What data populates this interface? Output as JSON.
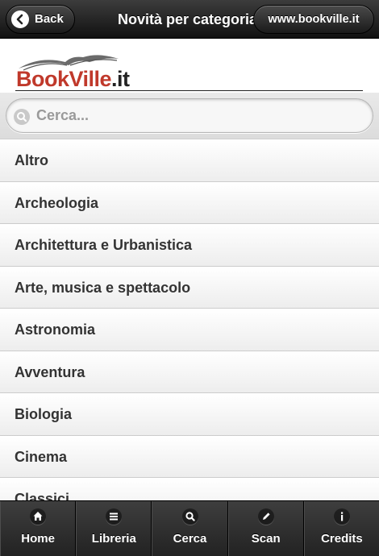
{
  "header": {
    "title": "Novità per categoria",
    "back_label": "Back",
    "site_label": "www.bookville.it"
  },
  "logo": {
    "name_main": "BookVille",
    "name_suffix": ".it"
  },
  "search": {
    "placeholder": "Cerca...",
    "value": ""
  },
  "categories": [
    {
      "label": "Altro"
    },
    {
      "label": "Archeologia"
    },
    {
      "label": "Architettura e Urbanistica"
    },
    {
      "label": "Arte, musica e spettacolo"
    },
    {
      "label": "Astronomia"
    },
    {
      "label": "Avventura"
    },
    {
      "label": "Biologia"
    },
    {
      "label": "Cinema"
    },
    {
      "label": "Classici"
    }
  ],
  "tabbar": {
    "items": [
      {
        "label": "Home",
        "icon": "home-icon"
      },
      {
        "label": "Libreria",
        "icon": "list-icon"
      },
      {
        "label": "Cerca",
        "icon": "search-icon"
      },
      {
        "label": "Scan",
        "icon": "pencil-icon"
      },
      {
        "label": "Credits",
        "icon": "info-icon"
      }
    ]
  },
  "colors": {
    "brand_red": "#c0392b",
    "header_dark": "#1b1b1b"
  }
}
